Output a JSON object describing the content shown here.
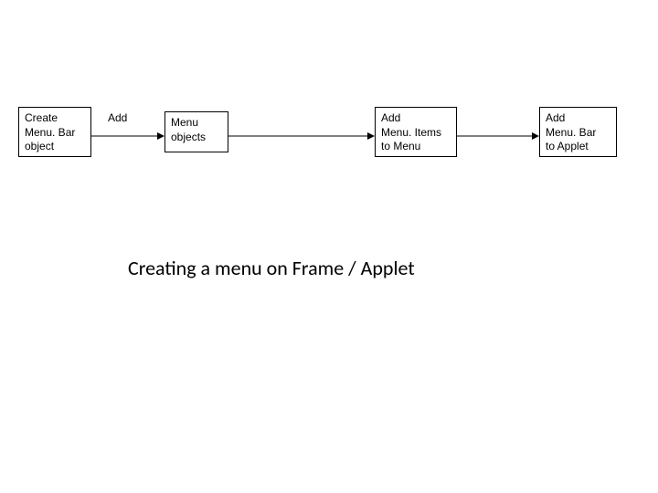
{
  "diagram": {
    "boxes": {
      "create_menubar": "Create\nMenu. Bar\nobject",
      "menu_objects": "Menu\nobjects",
      "add_menuitems": "Add\nMenu. Items\nto Menu",
      "add_menubar_applet": "Add\nMenu. Bar\nto Applet"
    },
    "labels": {
      "add": "Add"
    },
    "caption": "Creating a menu on Frame / Applet"
  }
}
